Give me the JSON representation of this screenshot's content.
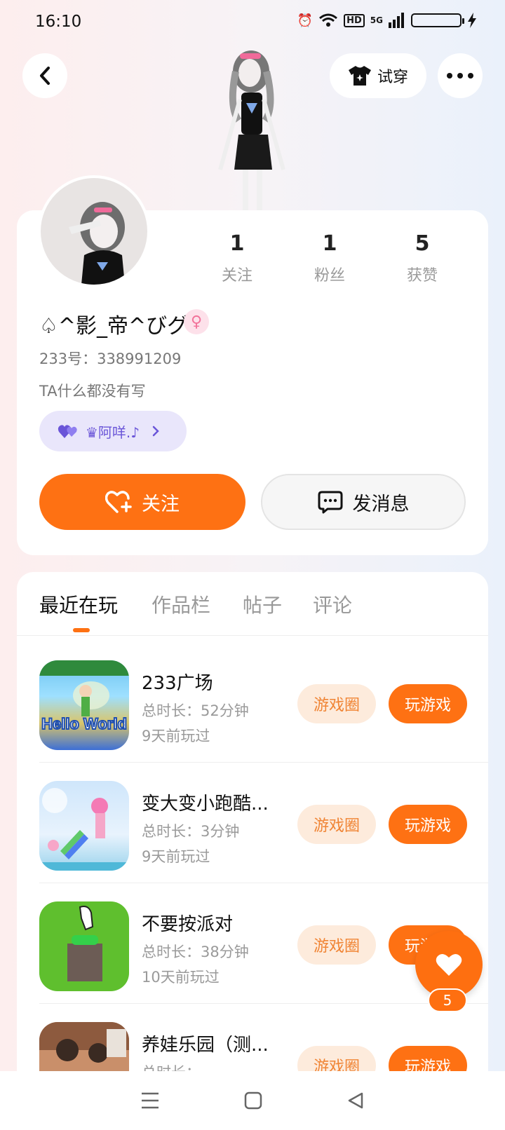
{
  "status_bar": {
    "time": "16:10",
    "hd": "HD",
    "network": "5G"
  },
  "header": {
    "tryon_label": "试穿"
  },
  "profile": {
    "stats": [
      {
        "value": "1",
        "label": "关注"
      },
      {
        "value": "1",
        "label": "粉丝"
      },
      {
        "value": "5",
        "label": "获赞"
      }
    ],
    "username": "♤^影_帝^びグ",
    "uid": "233号：338991209",
    "bio": "TA什么都没有写",
    "companion": "♛阿咩.♪",
    "follow_label": "关注",
    "message_label": "发消息"
  },
  "tabs": [
    {
      "label": "最近在玩",
      "active": true
    },
    {
      "label": "作品栏",
      "active": false
    },
    {
      "label": "帖子",
      "active": false
    },
    {
      "label": "评论",
      "active": false
    }
  ],
  "games": [
    {
      "name": "233广场",
      "duration": "总时长：52分钟",
      "last_played": "9天前玩过",
      "circle_label": "游戏圈",
      "play_label": "玩游戏",
      "thumb_text": "Hello World"
    },
    {
      "name": "变大变小跑酷...",
      "duration": "总时长：3分钟",
      "last_played": "9天前玩过",
      "circle_label": "游戏圈",
      "play_label": "玩游戏"
    },
    {
      "name": "不要按派对",
      "duration": "总时长：38分钟",
      "last_played": "10天前玩过",
      "circle_label": "游戏圈",
      "play_label": "玩游戏"
    },
    {
      "name": "养娃乐园（测...",
      "duration": "总时长：",
      "last_played": "",
      "circle_label": "游戏圈",
      "play_label": "玩游戏"
    }
  ],
  "like_fab": {
    "count": "5"
  },
  "colors": {
    "accent": "#fe7113",
    "accent_light": "#fdebdc",
    "companion_bg": "#e9e6fb"
  }
}
